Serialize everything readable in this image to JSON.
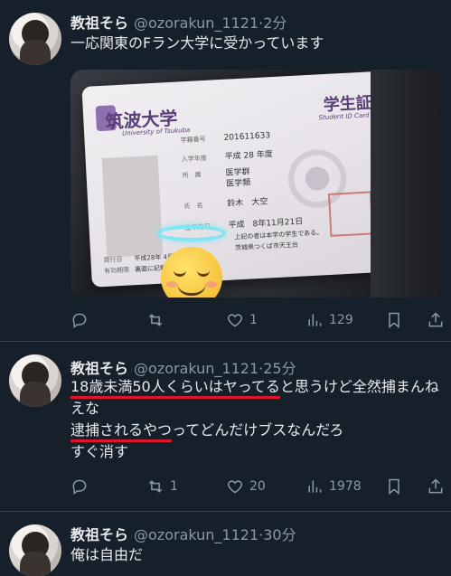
{
  "tweets": [
    {
      "name": "教祖そら",
      "handle": "@ozorakun_1121",
      "time": "2分",
      "text": "一応関東のFラン大学に受かっています",
      "actions": {
        "reply": "",
        "retweet": "",
        "like": "1",
        "views": "129"
      },
      "card": {
        "university": "筑波大学",
        "university_en": "University of Tsukuba",
        "id_title": "学生証",
        "id_title_en": "Student ID Card",
        "student_no_label": "学籍番号",
        "student_no": "201611633",
        "entry_label": "入学年度",
        "entry": "平成 28 年度",
        "dept_label": "所　属",
        "dept_1": "医学群",
        "dept_2": "医学類",
        "name_label": "氏　名",
        "name": "鈴木　大空",
        "birth_label": "生年月日",
        "birth": "平成　8年11月21日",
        "note": "上記の者は本学の学生である。",
        "address": "茨城県つくば市天王台",
        "issue_label": "発行日",
        "issue": "平成28年 4月 1日",
        "valid_label": "有効期限",
        "valid": "裏面に記載"
      }
    },
    {
      "name": "教祖そら",
      "handle": "@ozorakun_1121",
      "time": "25分",
      "text_parts": {
        "u1": "18歳未満50人くらいはヤってる",
        "t1": "と思うけど全然捕まんねえな",
        "u2": "逮捕されるやつ",
        "t2": "ってどんだけブスなんだろ",
        "t3": "すぐ消す"
      },
      "actions": {
        "reply": "",
        "retweet": "1",
        "like": "20",
        "views": "1978"
      }
    },
    {
      "name": "教祖そら",
      "handle": "@ozorakun_1121",
      "time": "30分",
      "text": "俺は自由だ"
    }
  ],
  "icons": [
    "reply-icon",
    "retweet-icon",
    "heart-icon",
    "views-icon",
    "bookmark-icon",
    "share-icon"
  ],
  "colors": {
    "background": "#15202b",
    "text": "#e7e9ea",
    "secondary": "#8b98a5",
    "underline": "#e0142a",
    "divider": "#38444d"
  }
}
